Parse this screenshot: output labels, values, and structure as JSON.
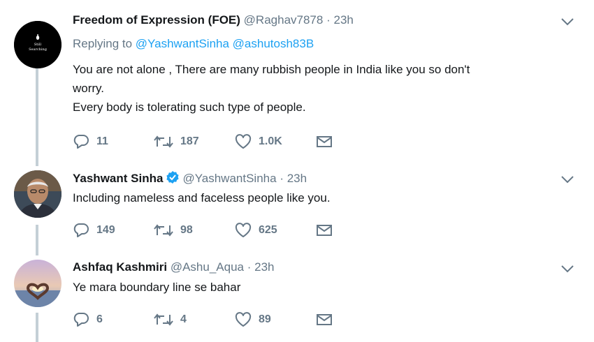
{
  "tweets": [
    {
      "name": "Freedom of Expression (FOE)",
      "handle": "@Raghav7878",
      "time": "23h",
      "replying_prefix": "Replying to",
      "replying_mentions": [
        "@YashwantSinha",
        "@ashutosh83B"
      ],
      "avatar_text": [
        "Still",
        "Searching"
      ],
      "lines": [
        "You are not alone , There are many rubbish people in India like you so don't",
        "worry.",
        "Every body is tolerating such type of people."
      ],
      "replies": "11",
      "retweets": "187",
      "likes": "1.0K"
    },
    {
      "name": "Yashwant Sinha",
      "verified": true,
      "handle": "@YashwantSinha",
      "time": "23h",
      "lines": [
        "Including nameless and faceless people like you."
      ],
      "replies": "149",
      "retweets": "98",
      "likes": "625"
    },
    {
      "name": "Ashfaq Kashmiri",
      "handle": "@Ashu_Aqua",
      "time": "23h",
      "lines": [
        "Ye mara boundary line se bahar"
      ],
      "replies": "6",
      "retweets": "4",
      "likes": "89"
    }
  ],
  "separator": "·",
  "icons": {
    "reply": "reply-icon",
    "retweet": "retweet-icon",
    "like": "heart-icon",
    "dm": "envelope-icon",
    "more": "chevron-down-icon",
    "verified": "verified-badge-icon"
  },
  "colors": {
    "name": "#14171a",
    "meta": "#657786",
    "link": "#1da1f2",
    "thread_line": "#c4cfd6",
    "verified": "#1da1f2"
  }
}
